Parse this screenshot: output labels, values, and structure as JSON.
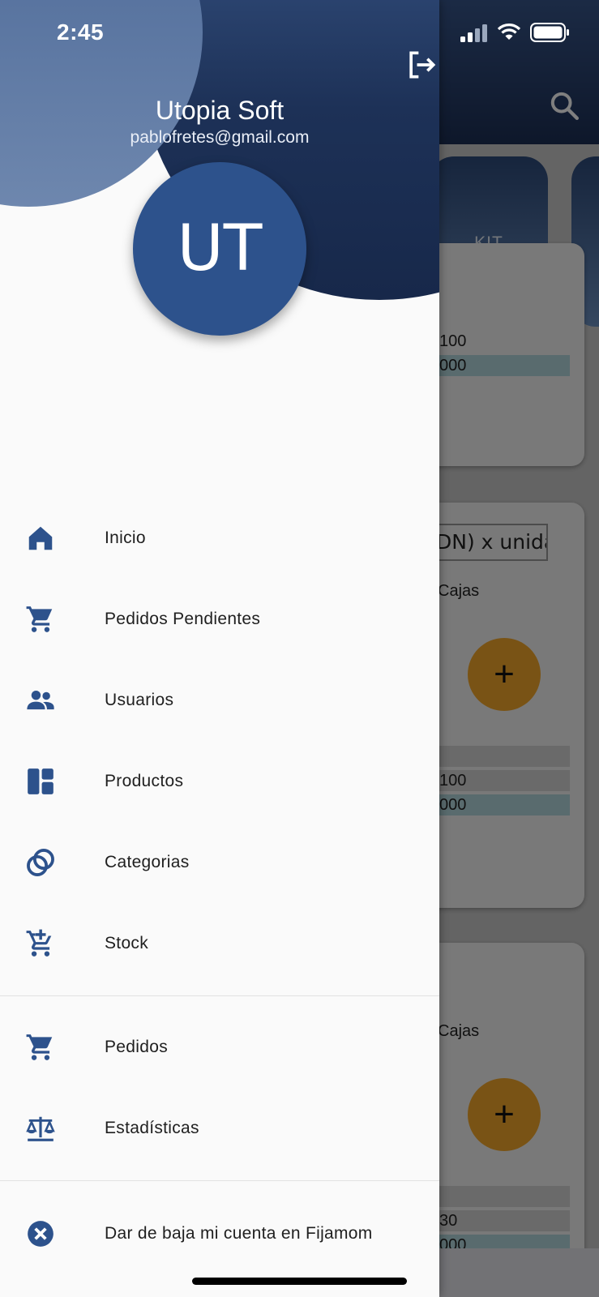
{
  "status_bar": {
    "time": "2:45"
  },
  "drawer": {
    "user_name": "Utopia Soft",
    "user_email": "pablofretes@gmail.com",
    "avatar_initials": "UT",
    "logout_icon": "logout-icon",
    "icon_color": "#2d528c",
    "menu_primary": [
      {
        "label": "Inicio",
        "icon": "home-icon"
      },
      {
        "label": "Pedidos Pendientes",
        "icon": "cart-icon"
      },
      {
        "label": "Usuarios",
        "icon": "people-icon"
      },
      {
        "label": "Productos",
        "icon": "dashboard-icon"
      },
      {
        "label": "Categorias",
        "icon": "rings-icon"
      },
      {
        "label": "Stock",
        "icon": "cart-add-icon"
      }
    ],
    "menu_secondary": [
      {
        "label": "Pedidos",
        "icon": "cart-icon"
      },
      {
        "label": "Estadísticas",
        "icon": "balance-scale-icon"
      }
    ],
    "menu_tertiary": [
      {
        "label": "Dar de baja mi cuenta en Fijamom",
        "icon": "cancel-icon"
      }
    ]
  },
  "background_app": {
    "search_icon": "search-icon",
    "category_label": "KIT",
    "card1": {
      "row1": "100",
      "row2": "000"
    },
    "card2": {
      "chip_text": "DN) x unidad",
      "cajas": "Cajas",
      "fab_symbol": "+",
      "row2": "100",
      "row3": "000"
    },
    "card3": {
      "cajas": "Cajas",
      "fab_symbol": "+",
      "row2": "30",
      "row3": "000"
    },
    "fab_color": "#f2a72a"
  }
}
